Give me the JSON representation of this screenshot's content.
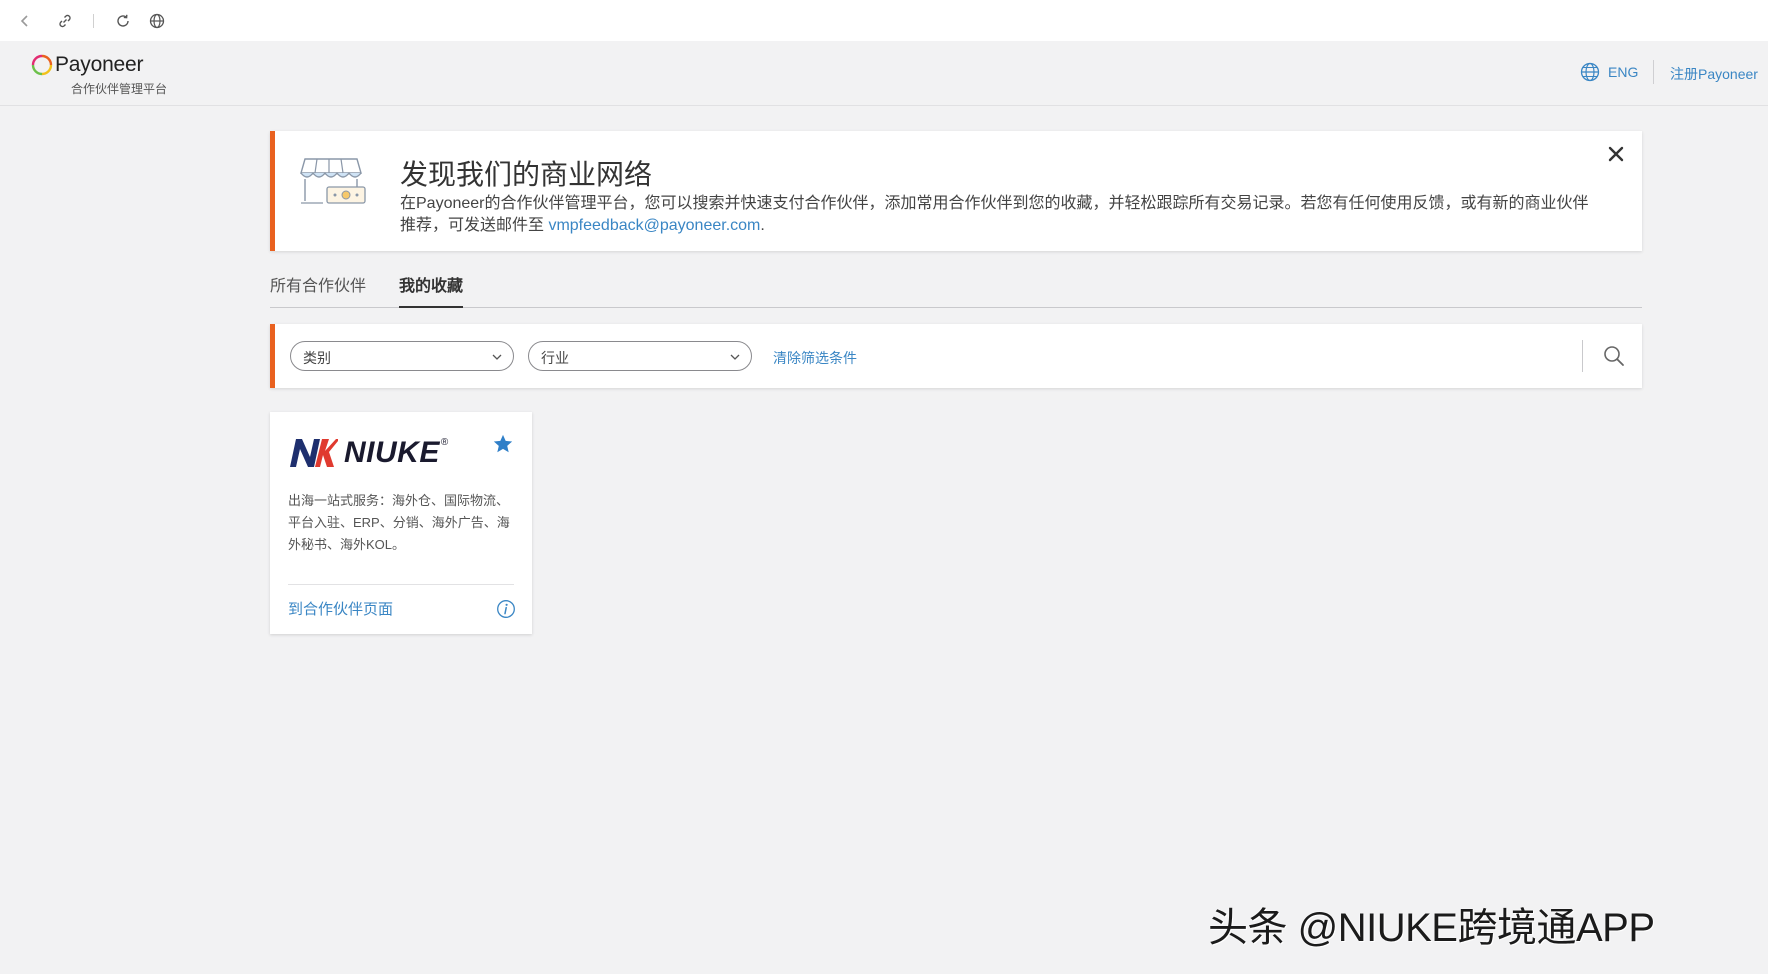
{
  "browser": {
    "icons": [
      "back-icon",
      "link-icon",
      "reload-icon",
      "globe-icon"
    ]
  },
  "header": {
    "brand": "Payoneer",
    "subtitle": "合作伙伴管理平台",
    "language": "ENG",
    "register": "注册Payoneer"
  },
  "banner": {
    "title": "发现我们的商业网络",
    "text": "在Payoneer的合作伙伴管理平台，您可以搜索并快速支付合作伙伴，添加常用合作伙伴到您的收藏，并轻松跟踪所有交易记录。若您有任何使用反馈，或有新的商业伙伴推荐，可发送邮件至 ",
    "email": "vmpfeedback@payoneer.com",
    "text_end": "."
  },
  "tabs": [
    {
      "label": "所有合作伙伴",
      "active": false
    },
    {
      "label": "我的收藏",
      "active": true
    }
  ],
  "filters": {
    "category": "类别",
    "industry": "行业",
    "clear": "清除筛选条件"
  },
  "partner_card": {
    "logo_text": "NIUKE",
    "logo_reg": "®",
    "description": "出海一站式服务：海外仓、国际物流、平台入驻、ERP、分销、海外广告、海外秘书、海外KOL。",
    "link": "到合作伙伴页面",
    "favorited": true
  },
  "watermark": "头条 @NIUKE跨境通APP",
  "colors": {
    "accent": "#e9611f",
    "link": "#3a86c4",
    "star": "#2f7fc8",
    "background": "#f2f2f3"
  }
}
